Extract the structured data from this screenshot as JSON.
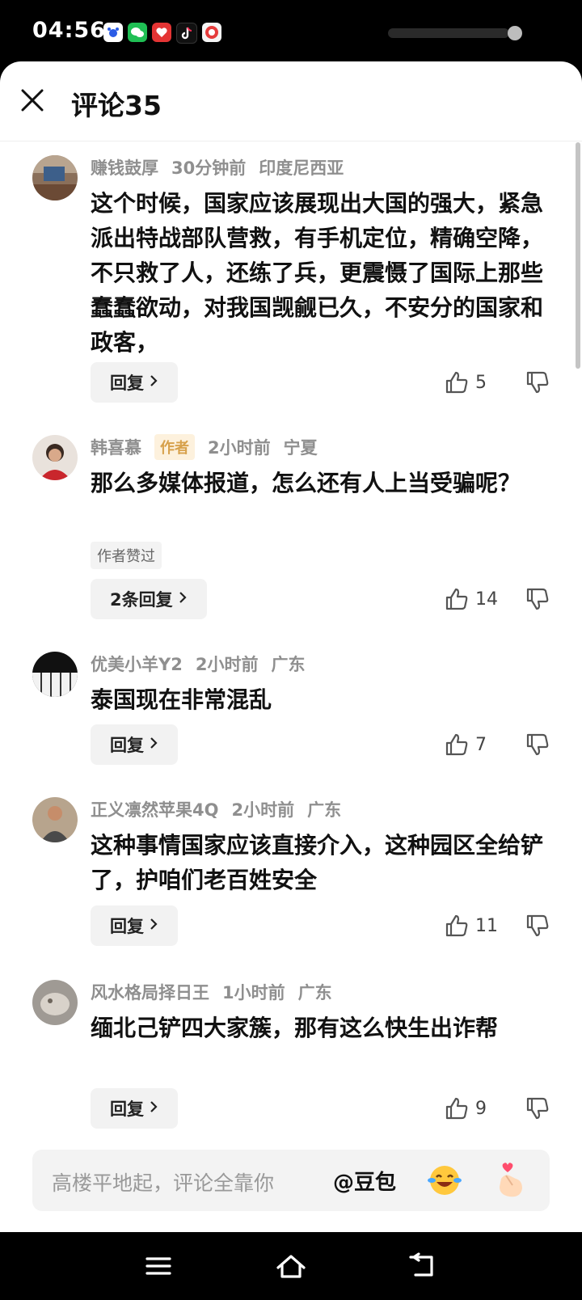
{
  "status_bar": {
    "time": "04:56",
    "app_icons": [
      "baidu-icon",
      "wechat-icon",
      "red-app-icon",
      "tiktok-icon",
      "game-app-icon"
    ]
  },
  "header": {
    "title": "评论35"
  },
  "comments": [
    {
      "username": "赚钱鼓厚",
      "time": "30分钟前",
      "location": "印度尼西亚",
      "text": "这个时候，国家应该展现出大国的强大，紧急派出特战部队营救，有手机定位，精确空降，不只救了人，还练了兵，更震慑了国际上那些蠢蠢欲动，对我国觊觎已久，不安分的国家和政客，",
      "reply_label": "回复",
      "likes": "5"
    },
    {
      "username": "韩喜慕",
      "author_tag": "作者",
      "time": "2小时前",
      "location": "宁夏",
      "text": "那么多媒体报道，怎么还有人上当受骗呢？",
      "liked_by_author": "作者赞过",
      "reply_label": "2条回复",
      "likes": "14"
    },
    {
      "username": "优美小羊Y2",
      "time": "2小时前",
      "location": "广东",
      "text": "泰国现在非常混乱",
      "reply_label": "回复",
      "likes": "7"
    },
    {
      "username": "正义凛然苹果4Q",
      "time": "2小时前",
      "location": "广东",
      "text": "这种事情国家应该直接介入，这种园区全给铲了，护咱们老百姓安全",
      "reply_label": "回复",
      "likes": "11"
    },
    {
      "username": "风水格局择日王",
      "time": "1小时前",
      "location": "广东",
      "text": "缅北己铲四大家簇，那有这么快生出诈帮",
      "reply_label": "回复",
      "likes": "9"
    }
  ],
  "composer": {
    "placeholder": "高楼平地起，评论全靠你",
    "mention": "@豆包",
    "emojis": [
      "laughing-tears-emoji",
      "finger-heart-emoji"
    ]
  },
  "nav_bar": {
    "buttons": [
      "menu-icon",
      "home-icon",
      "back-icon"
    ]
  }
}
